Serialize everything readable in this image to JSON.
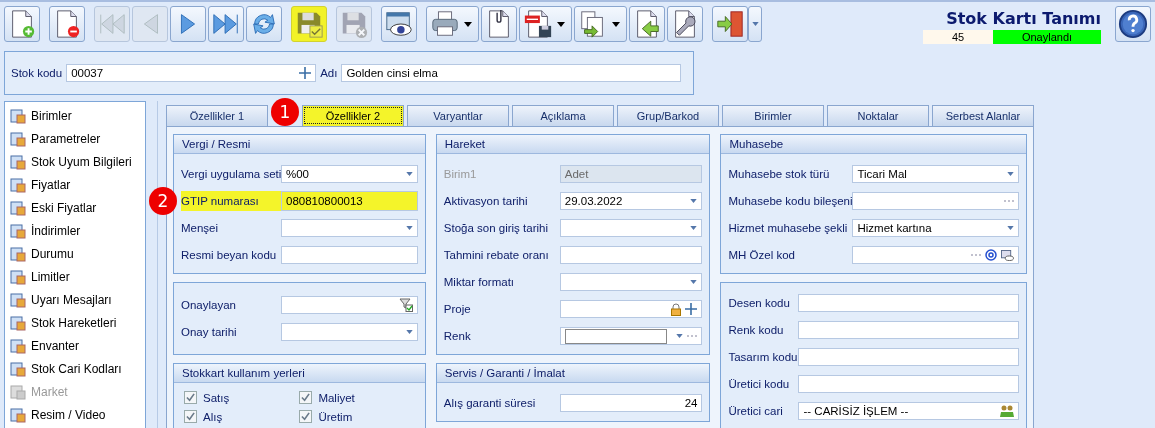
{
  "toolbar": [
    [
      {
        "kind": "new",
        "disabled": false,
        "highlighted": false
      }
    ],
    [
      {
        "kind": "delete",
        "disabled": false,
        "highlighted": false
      }
    ],
    [
      {
        "kind": "first",
        "disabled": true,
        "highlighted": false
      },
      {
        "kind": "prev",
        "disabled": true,
        "highlighted": false
      },
      {
        "kind": "next",
        "disabled": false,
        "highlighted": false
      },
      {
        "kind": "last",
        "disabled": false,
        "highlighted": false
      },
      {
        "kind": "refresh",
        "disabled": false,
        "highlighted": false
      }
    ],
    [
      {
        "kind": "save",
        "disabled": false,
        "highlighted": true
      }
    ],
    [
      {
        "kind": "cancel-save",
        "disabled": true,
        "highlighted": false
      }
    ],
    [
      {
        "kind": "preview",
        "disabled": false,
        "highlighted": false
      }
    ],
    [
      {
        "kind": "print",
        "disabled": false,
        "highlighted": false,
        "dropdown": true
      },
      {
        "kind": "attach",
        "disabled": false,
        "highlighted": false
      },
      {
        "kind": "pdf",
        "disabled": false,
        "highlighted": false,
        "dropdown": true
      },
      {
        "kind": "copy",
        "disabled": false,
        "highlighted": false,
        "dropdown": true
      },
      {
        "kind": "import",
        "disabled": false,
        "highlighted": false
      },
      {
        "kind": "tools",
        "disabled": false,
        "highlighted": false
      }
    ],
    [
      {
        "kind": "exit",
        "disabled": false,
        "highlighted": false,
        "split_dropdown": true
      }
    ]
  ],
  "header": {
    "title": "Stok Kartı Tanımı",
    "count": "45",
    "status": "Onaylandı"
  },
  "stock": {
    "code_label": "Stok kodu",
    "code": "00037",
    "name_label": "Adı",
    "name": "Golden cinsi elma"
  },
  "sidebar": {
    "items": [
      {
        "label": "Birimler",
        "disabled": false
      },
      {
        "label": "Parametreler",
        "disabled": false
      },
      {
        "label": "Stok Uyum Bilgileri",
        "disabled": false
      },
      {
        "label": "Fiyatlar",
        "disabled": false
      },
      {
        "label": "Eski Fiyatlar",
        "disabled": false
      },
      {
        "label": "İndirimler",
        "disabled": false
      },
      {
        "label": "Durumu",
        "disabled": false
      },
      {
        "label": "Limitler",
        "disabled": false
      },
      {
        "label": "Uyarı Mesajları",
        "disabled": false
      },
      {
        "label": "Stok Hareketleri",
        "disabled": false
      },
      {
        "label": "Envanter",
        "disabled": false
      },
      {
        "label": "Stok Cari Kodları",
        "disabled": false
      },
      {
        "label": "Market",
        "disabled": true
      },
      {
        "label": "Resim / Video",
        "disabled": false
      }
    ]
  },
  "tabs": [
    {
      "label": "Özellikler 1",
      "selected": false
    },
    {
      "label": "Özellikler 2",
      "selected": true,
      "callout": "1"
    },
    {
      "label": "Varyantlar",
      "selected": false
    },
    {
      "label": "Açıklama",
      "selected": false
    },
    {
      "label": "Grup/Barkod",
      "selected": false
    },
    {
      "label": "Birimler",
      "selected": false
    },
    {
      "label": "Noktalar",
      "selected": false
    },
    {
      "label": "Serbest Alanlar",
      "selected": false
    }
  ],
  "columns": [
    [
      {
        "title": "Vergi / Resmi",
        "fields": [
          {
            "label": "Vergi uygulama seti",
            "value": "%00",
            "kind": "dropdown",
            "highlighted": false
          },
          {
            "label": "GTIP numarası",
            "value": "080810800013",
            "kind": "text",
            "highlighted": true,
            "callout": "2"
          },
          {
            "label": "Menşei",
            "kind": "dropdown",
            "highlighted": false
          },
          {
            "label": "Resmi beyan kodu",
            "kind": "text",
            "highlighted": false
          }
        ]
      },
      {
        "fields": [
          {
            "label": "Onaylayan",
            "kind": "filter",
            "highlighted": false
          },
          {
            "label": "Onay tarihi",
            "kind": "dropdown",
            "highlighted": false
          }
        ]
      },
      {
        "title": "Stokkart kullanım yerleri",
        "checks": [
          {
            "label": "Satış",
            "checked": true
          },
          {
            "label": "Maliyet",
            "checked": true
          },
          {
            "label": "Alış",
            "checked": true
          },
          {
            "label": "Üretim",
            "checked": true
          }
        ]
      }
    ],
    [
      {
        "title": "Hareket",
        "fields": [
          {
            "label": "Birim1",
            "value": "Adet",
            "kind": "disabled",
            "highlighted": false
          },
          {
            "label": "Aktivasyon tarihi",
            "value": "29.03.2022",
            "kind": "dropdown",
            "highlighted": false
          },
          {
            "label": "Stoğa son giriş tarihi",
            "kind": "dropdown",
            "highlighted": false
          },
          {
            "label": "Tahmini rebate oranı",
            "kind": "text",
            "highlighted": false
          },
          {
            "label": "Miktar formatı",
            "kind": "dropdown",
            "highlighted": false
          },
          {
            "label": "Proje",
            "kind": "lock-plus",
            "highlighted": false
          },
          {
            "label": "Renk",
            "kind": "color",
            "highlighted": false
          }
        ]
      },
      {
        "title": "Servis / Garanti / İmalat",
        "fields": [
          {
            "label": "Alış garanti süresi",
            "value": "24",
            "kind": "number",
            "highlighted": false
          }
        ]
      }
    ],
    [
      {
        "title": "Muhasebe",
        "fields": [
          {
            "label": "Muhasebe stok türü",
            "value": "Ticari Mal",
            "kind": "dropdown",
            "highlighted": false
          },
          {
            "label": "Muhasebe kodu bileşeni",
            "kind": "ellipsis",
            "highlighted": false
          },
          {
            "label": "Hizmet muhasebe şekli",
            "value": "Hizmet kartına",
            "kind": "dropdown",
            "highlighted": false
          },
          {
            "label": "MH Özel kod",
            "kind": "code",
            "highlighted": false
          }
        ]
      },
      {
        "fields": [
          {
            "label": "Desen kodu",
            "kind": "text",
            "highlighted": false
          },
          {
            "label": "Renk kodu",
            "kind": "text",
            "highlighted": false
          },
          {
            "label": "Tasarım kodu",
            "kind": "text",
            "highlighted": false
          },
          {
            "label": "Üretici kodu",
            "kind": "text",
            "highlighted": false
          },
          {
            "label": "Üretici cari",
            "value": "-- CARİSİZ İŞLEM --",
            "kind": "people",
            "highlighted": false
          }
        ]
      }
    ]
  ]
}
